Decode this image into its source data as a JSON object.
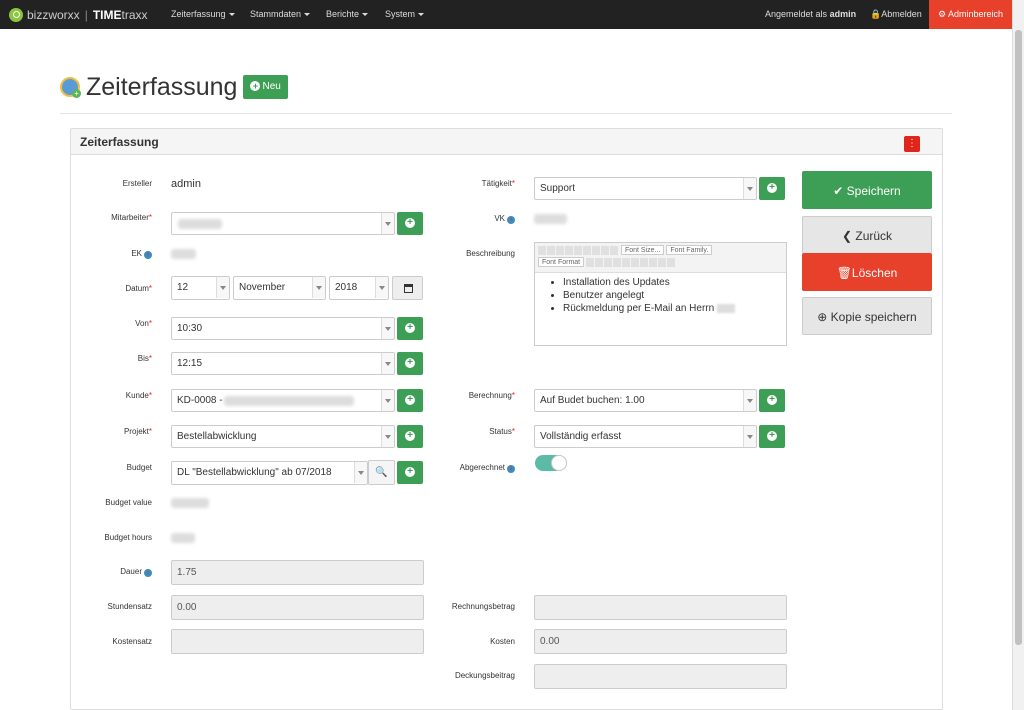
{
  "nav": {
    "brand": "bizzworxx",
    "product_bold": "TIME",
    "product_rest": "traxx",
    "menu": [
      "Zeiterfassung",
      "Stammdaten",
      "Berichte",
      "System"
    ],
    "logged_in_prefix": "Angemeldet als",
    "logged_in_user": "admin",
    "logout": "Abmelden",
    "admin": "Adminbereich"
  },
  "page": {
    "title": "Zeiterfassung",
    "new_button": "Neu"
  },
  "panel": {
    "title": "Zeiterfassung"
  },
  "left": {
    "ersteller_label": "Ersteller",
    "ersteller_value": "admin",
    "mitarbeiter_label": "Mitarbeiter",
    "ek_label": "EK",
    "datum_label": "Datum",
    "day": "12",
    "month": "November",
    "year": "2018",
    "von_label": "Von",
    "von_value": "10:30",
    "bis_label": "Bis",
    "bis_value": "12:15",
    "kunde_label": "Kunde",
    "kunde_value": "KD-0008 -",
    "projekt_label": "Projekt",
    "projekt_value": "Bestellabwicklung",
    "budget_label": "Budget",
    "budget_value": "DL \"Bestellabwicklung\" ab 07/2018",
    "budget_value_label": "Budget value",
    "budget_hours_label": "Budget hours",
    "dauer_label": "Dauer",
    "dauer_value": "1.75",
    "stundensatz_label": "Stundensatz",
    "stundensatz_value": "0.00",
    "kostensatz_label": "Kostensatz"
  },
  "right": {
    "taetigkeit_label": "Tätigkeit",
    "taetigkeit_value": "Support",
    "vk_label": "VK",
    "beschreibung_label": "Beschreibung",
    "editor_font_size": "Font Size...",
    "editor_font_family": "Font Family.",
    "editor_font_format": "Font Format",
    "bullets": [
      "Installation des Updates",
      "Benutzer angelegt",
      "Rückmeldung per E-Mail an Herrn"
    ],
    "berechnung_label": "Berechnung",
    "berechnung_value": "Auf Budet buchen: 1.00",
    "status_label": "Status",
    "status_value": "Vollständig erfasst",
    "abgerechnet_label": "Abgerechnet",
    "rechnungsbetrag_label": "Rechnungsbetrag",
    "kosten_label": "Kosten",
    "kosten_value": "0.00",
    "deckungsbeitrag_label": "Deckungsbeitrag"
  },
  "actions": {
    "save": "Speichern",
    "back": "Zurück",
    "delete": "Löschen",
    "copy_save": "Kopie speichern"
  },
  "colors": {
    "green": "#3c9f55",
    "red": "#e8412b",
    "navbar": "#222222",
    "toggle": "#5cbba6"
  }
}
